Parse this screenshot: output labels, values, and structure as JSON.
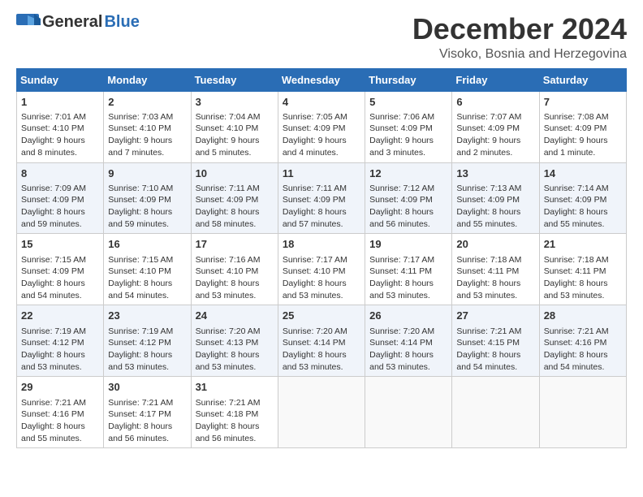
{
  "header": {
    "logo_general": "General",
    "logo_blue": "Blue",
    "month_title": "December 2024",
    "location": "Visoko, Bosnia and Herzegovina"
  },
  "days_of_week": [
    "Sunday",
    "Monday",
    "Tuesday",
    "Wednesday",
    "Thursday",
    "Friday",
    "Saturday"
  ],
  "weeks": [
    [
      {
        "day": "1",
        "sunrise": "Sunrise: 7:01 AM",
        "sunset": "Sunset: 4:10 PM",
        "daylight": "Daylight: 9 hours and 8 minutes."
      },
      {
        "day": "2",
        "sunrise": "Sunrise: 7:03 AM",
        "sunset": "Sunset: 4:10 PM",
        "daylight": "Daylight: 9 hours and 7 minutes."
      },
      {
        "day": "3",
        "sunrise": "Sunrise: 7:04 AM",
        "sunset": "Sunset: 4:10 PM",
        "daylight": "Daylight: 9 hours and 5 minutes."
      },
      {
        "day": "4",
        "sunrise": "Sunrise: 7:05 AM",
        "sunset": "Sunset: 4:09 PM",
        "daylight": "Daylight: 9 hours and 4 minutes."
      },
      {
        "day": "5",
        "sunrise": "Sunrise: 7:06 AM",
        "sunset": "Sunset: 4:09 PM",
        "daylight": "Daylight: 9 hours and 3 minutes."
      },
      {
        "day": "6",
        "sunrise": "Sunrise: 7:07 AM",
        "sunset": "Sunset: 4:09 PM",
        "daylight": "Daylight: 9 hours and 2 minutes."
      },
      {
        "day": "7",
        "sunrise": "Sunrise: 7:08 AM",
        "sunset": "Sunset: 4:09 PM",
        "daylight": "Daylight: 9 hours and 1 minute."
      }
    ],
    [
      {
        "day": "8",
        "sunrise": "Sunrise: 7:09 AM",
        "sunset": "Sunset: 4:09 PM",
        "daylight": "Daylight: 8 hours and 59 minutes."
      },
      {
        "day": "9",
        "sunrise": "Sunrise: 7:10 AM",
        "sunset": "Sunset: 4:09 PM",
        "daylight": "Daylight: 8 hours and 59 minutes."
      },
      {
        "day": "10",
        "sunrise": "Sunrise: 7:11 AM",
        "sunset": "Sunset: 4:09 PM",
        "daylight": "Daylight: 8 hours and 58 minutes."
      },
      {
        "day": "11",
        "sunrise": "Sunrise: 7:11 AM",
        "sunset": "Sunset: 4:09 PM",
        "daylight": "Daylight: 8 hours and 57 minutes."
      },
      {
        "day": "12",
        "sunrise": "Sunrise: 7:12 AM",
        "sunset": "Sunset: 4:09 PM",
        "daylight": "Daylight: 8 hours and 56 minutes."
      },
      {
        "day": "13",
        "sunrise": "Sunrise: 7:13 AM",
        "sunset": "Sunset: 4:09 PM",
        "daylight": "Daylight: 8 hours and 55 minutes."
      },
      {
        "day": "14",
        "sunrise": "Sunrise: 7:14 AM",
        "sunset": "Sunset: 4:09 PM",
        "daylight": "Daylight: 8 hours and 55 minutes."
      }
    ],
    [
      {
        "day": "15",
        "sunrise": "Sunrise: 7:15 AM",
        "sunset": "Sunset: 4:09 PM",
        "daylight": "Daylight: 8 hours and 54 minutes."
      },
      {
        "day": "16",
        "sunrise": "Sunrise: 7:15 AM",
        "sunset": "Sunset: 4:10 PM",
        "daylight": "Daylight: 8 hours and 54 minutes."
      },
      {
        "day": "17",
        "sunrise": "Sunrise: 7:16 AM",
        "sunset": "Sunset: 4:10 PM",
        "daylight": "Daylight: 8 hours and 53 minutes."
      },
      {
        "day": "18",
        "sunrise": "Sunrise: 7:17 AM",
        "sunset": "Sunset: 4:10 PM",
        "daylight": "Daylight: 8 hours and 53 minutes."
      },
      {
        "day": "19",
        "sunrise": "Sunrise: 7:17 AM",
        "sunset": "Sunset: 4:11 PM",
        "daylight": "Daylight: 8 hours and 53 minutes."
      },
      {
        "day": "20",
        "sunrise": "Sunrise: 7:18 AM",
        "sunset": "Sunset: 4:11 PM",
        "daylight": "Daylight: 8 hours and 53 minutes."
      },
      {
        "day": "21",
        "sunrise": "Sunrise: 7:18 AM",
        "sunset": "Sunset: 4:11 PM",
        "daylight": "Daylight: 8 hours and 53 minutes."
      }
    ],
    [
      {
        "day": "22",
        "sunrise": "Sunrise: 7:19 AM",
        "sunset": "Sunset: 4:12 PM",
        "daylight": "Daylight: 8 hours and 53 minutes."
      },
      {
        "day": "23",
        "sunrise": "Sunrise: 7:19 AM",
        "sunset": "Sunset: 4:12 PM",
        "daylight": "Daylight: 8 hours and 53 minutes."
      },
      {
        "day": "24",
        "sunrise": "Sunrise: 7:20 AM",
        "sunset": "Sunset: 4:13 PM",
        "daylight": "Daylight: 8 hours and 53 minutes."
      },
      {
        "day": "25",
        "sunrise": "Sunrise: 7:20 AM",
        "sunset": "Sunset: 4:14 PM",
        "daylight": "Daylight: 8 hours and 53 minutes."
      },
      {
        "day": "26",
        "sunrise": "Sunrise: 7:20 AM",
        "sunset": "Sunset: 4:14 PM",
        "daylight": "Daylight: 8 hours and 53 minutes."
      },
      {
        "day": "27",
        "sunrise": "Sunrise: 7:21 AM",
        "sunset": "Sunset: 4:15 PM",
        "daylight": "Daylight: 8 hours and 54 minutes."
      },
      {
        "day": "28",
        "sunrise": "Sunrise: 7:21 AM",
        "sunset": "Sunset: 4:16 PM",
        "daylight": "Daylight: 8 hours and 54 minutes."
      }
    ],
    [
      {
        "day": "29",
        "sunrise": "Sunrise: 7:21 AM",
        "sunset": "Sunset: 4:16 PM",
        "daylight": "Daylight: 8 hours and 55 minutes."
      },
      {
        "day": "30",
        "sunrise": "Sunrise: 7:21 AM",
        "sunset": "Sunset: 4:17 PM",
        "daylight": "Daylight: 8 hours and 56 minutes."
      },
      {
        "day": "31",
        "sunrise": "Sunrise: 7:21 AM",
        "sunset": "Sunset: 4:18 PM",
        "daylight": "Daylight: 8 hours and 56 minutes."
      },
      null,
      null,
      null,
      null
    ]
  ]
}
